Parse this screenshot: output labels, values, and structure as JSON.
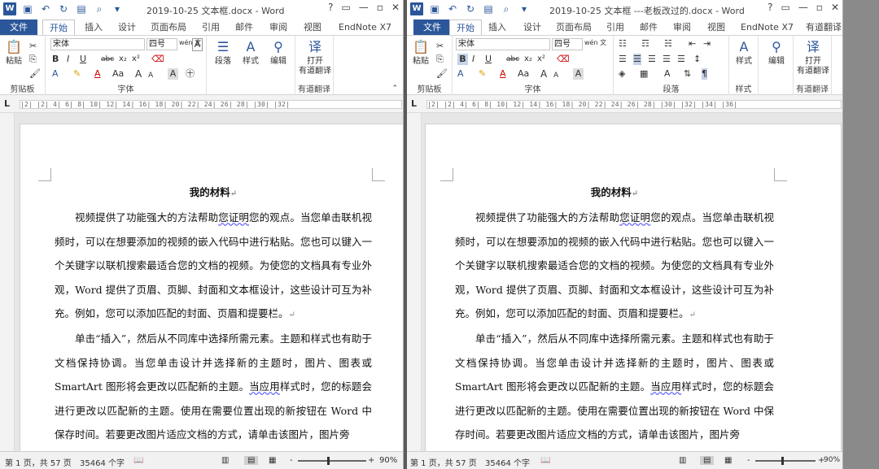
{
  "left_window": {
    "title": "2019-10-25 文本框.docx - Word",
    "controls": [
      "?",
      "▭",
      "—",
      "▫",
      "✕"
    ],
    "tabs": {
      "file": "文件",
      "home": "开始",
      "insert": "插入",
      "design": "设计",
      "layout": "页面布局",
      "references": "引用",
      "mailings": "邮件",
      "review": "审阅",
      "view": "视图",
      "endnote": "EndNote X7"
    },
    "ribbon": {
      "paste": "粘贴",
      "clipboard": "剪贴板",
      "font_name": "宋体",
      "font_size": "四号",
      "font_group": "字体",
      "wen_label": "wén 文",
      "paragraph": "段落",
      "styles": "样式",
      "editing": "编辑",
      "youdao_open": "打开",
      "youdao_name": "有道翻译",
      "youdao_group": "有道翻译",
      "fmt_bold": "B",
      "fmt_italic": "I",
      "fmt_underline": "U",
      "fmt_strike": "abc",
      "fmt_sub": "x₂",
      "fmt_sup": "x²",
      "grow": "A",
      "shrink": "A",
      "clear": "A",
      "font_color": "A",
      "aa": "Aa"
    },
    "ruler": "  |2|  |2|  4|  6|  8|  10|  12|  14|  16|  18|  20|  22|  24|  26|  28|  |30|  |32|",
    "status": {
      "page": "第 1 页，共 57 页",
      "words": "35464 个字",
      "zoom": "90%",
      "minus": "-",
      "plus": "+"
    }
  },
  "right_window": {
    "title": "2019-10-25 文本框 ---老板改过的.docx - Word",
    "controls": [
      "?",
      "▭",
      "—",
      "▫",
      "✕"
    ],
    "tabs": {
      "file": "文件",
      "home": "开始",
      "insert": "插入",
      "design": "设计",
      "layout": "页面布局",
      "references": "引用",
      "mailings": "邮件",
      "review": "审阅",
      "view": "视图",
      "endnote": "EndNote X7",
      "youdao": "有道翻译"
    },
    "ribbon": {
      "paste": "粘贴",
      "clipboard": "剪贴板",
      "font_name": "宋体",
      "font_size": "四号",
      "font_group": "字体",
      "paragraph_group": "段落",
      "styles": "样式",
      "styles_group": "样式",
      "editing": "编辑",
      "youdao_open": "打开",
      "youdao_name": "有道翻译",
      "youdao_group": "有道翻译",
      "fmt_bold": "B",
      "fmt_italic": "I",
      "fmt_underline": "U",
      "fmt_strike": "abc",
      "fmt_sub": "x₂",
      "fmt_sup": "x²",
      "grow": "A",
      "shrink": "A",
      "clear": "A",
      "font_color": "A",
      "aa": "Aa",
      "wen_label": "wén 文"
    },
    "ruler": "  |2|  |2|  4|  6|  8|  10|  12|  14|  16|  18|  20|  22|  24|  26|  28|  |30|  |32|  |34|  |36|",
    "status": {
      "page": "第 1 页，共 57 页",
      "words": "35464 个字",
      "zoom": "90%",
      "minus": "-",
      "plus": "+"
    }
  },
  "document": {
    "title": "我的材料",
    "p1a": "视频提供了功能强大的方法帮助",
    "p1_underlined": "您证明",
    "p1b": "您的观点。当您单击联机视频时，可以在想要添加的视频的嵌入代码中进行粘贴。您也可以键入一个关键字以联机搜索最适合您的文档的视频。为使您的文档具有专业外观，Word 提供了页眉、页脚、封面和文本框设计，这些设计可互为补充。例如，您可以添加匹配的封面、页眉和提要栏。",
    "p2a": "单击“插入”，然后从不同库中选择所需元素。主题和样式也有助于文档保持协调。当您单击设计并选择新的主题时，图片、图表或 SmartArt 图形将会更改以匹配新的主题。",
    "p2_underlined": "当应用",
    "p2b": "样式时，您的标题会进行更改以匹配新的主题。使用在需要位置出现的新按钮在 Word 中保存时间。若要更改图片适应文档的方式，请单击该图片，图片旁",
    "mark": "↵"
  },
  "colors": {
    "accent": "#2b579a",
    "file_tab": "#2b579a",
    "status_bg": "#f1f1f1"
  }
}
